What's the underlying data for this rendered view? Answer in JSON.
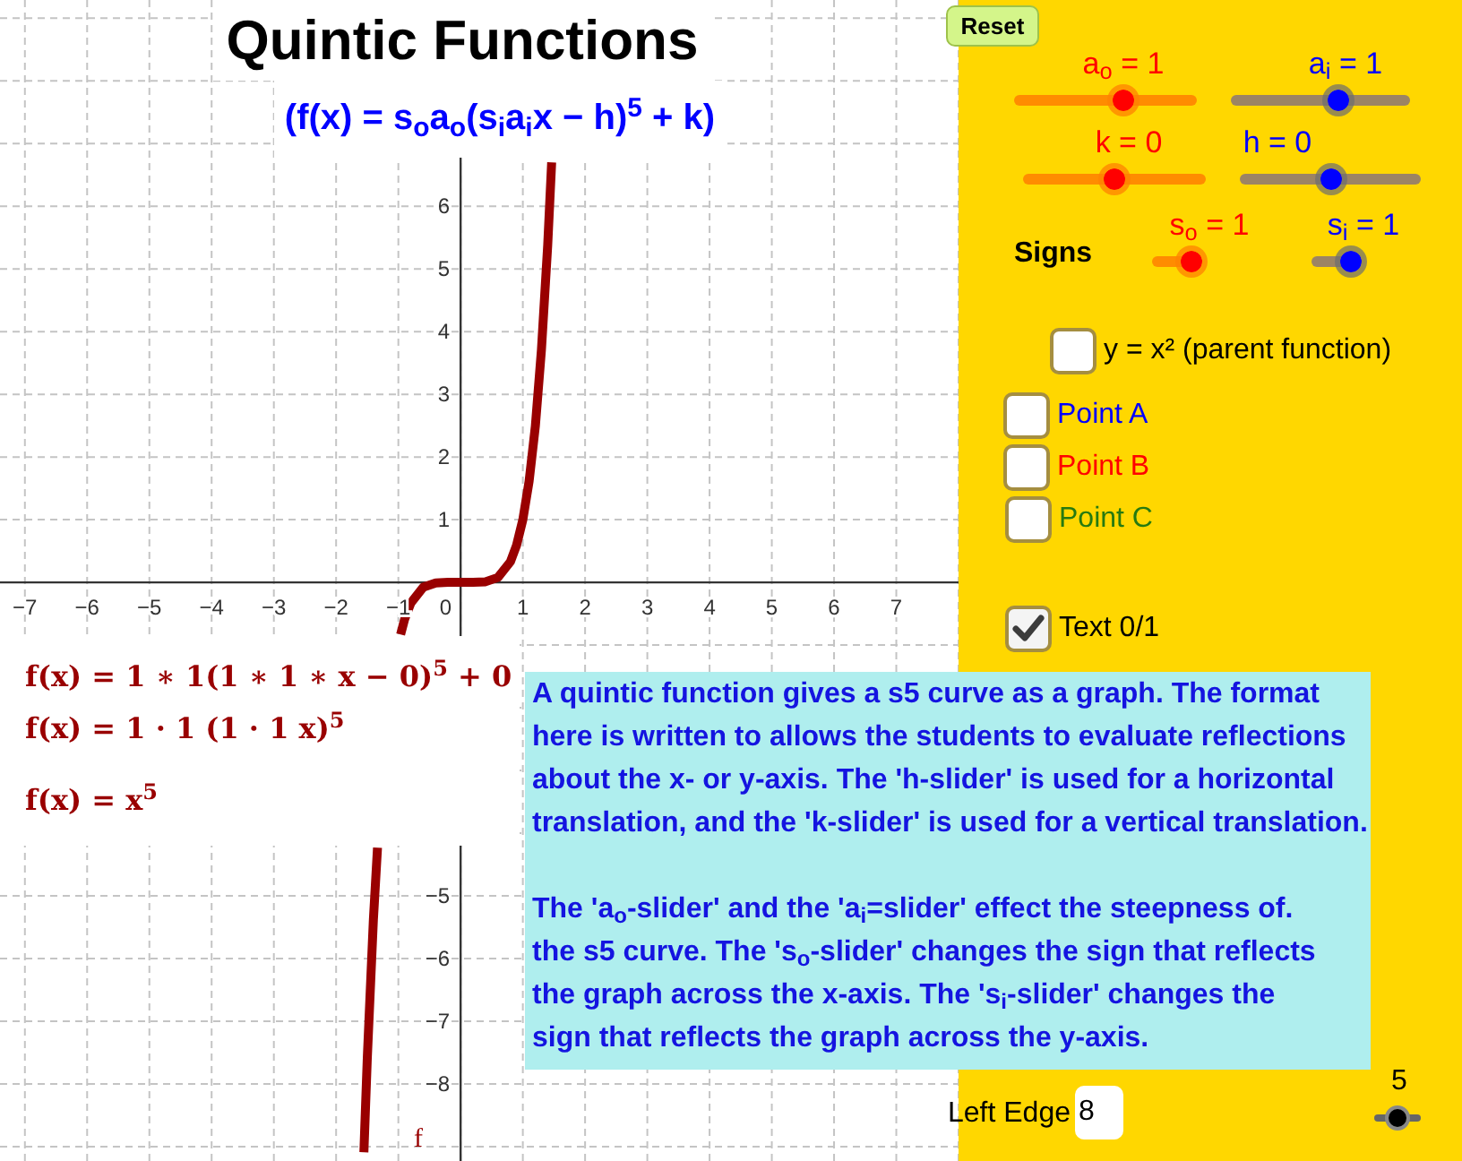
{
  "title": "Quintic Functions",
  "general_form": "(f(x) = s$_{o}$a$_{o}$(s$_{i}$a$_{i}$x − h)$^{5}$ + k)",
  "graph": {
    "origin_label": "0",
    "chart_data": {
      "type": "line",
      "grid": true,
      "x": [
        -1.555,
        -1.5,
        -1.4,
        -1.334,
        -1.1,
        -0.963,
        -0.9,
        -0.8,
        -0.6,
        -0.4,
        -0.2,
        0,
        0.2,
        0.4,
        0.6,
        0.8,
        0.9,
        1,
        1.1,
        1.2,
        1.3,
        1.4,
        1.463
      ],
      "series": [
        {
          "name": "f",
          "color": "#990000",
          "values": [
            -9.09,
            -7.59,
            -5.38,
            -4.23,
            null,
            -0.83,
            -0.59,
            -0.33,
            -0.08,
            -0.01,
            0,
            0,
            0,
            0.01,
            0.08,
            0.33,
            0.59,
            1,
            1.61,
            2.49,
            3.71,
            5.38,
            6.7
          ]
        }
      ],
      "xlim": [
        -7.4,
        8.0
      ],
      "ylim": [
        -9.23,
        9.29
      ],
      "xticks": [
        {
          "value": -7,
          "label": "−7"
        },
        {
          "value": -6,
          "label": "−6"
        },
        {
          "value": -5,
          "label": "−5"
        },
        {
          "value": -4,
          "label": "−4"
        },
        {
          "value": -3,
          "label": "−3"
        },
        {
          "value": -2,
          "label": "−2"
        },
        {
          "value": -1,
          "label": "−1"
        },
        1,
        2,
        3,
        4,
        5,
        6,
        7
      ],
      "yticks": [
        {
          "value": -8,
          "label": "−8"
        },
        {
          "value": -7,
          "label": "−7"
        },
        {
          "value": -6,
          "label": "−6"
        },
        {
          "value": -5,
          "label": "−5"
        },
        1,
        2,
        3,
        4,
        5,
        6
      ]
    }
  },
  "formulas": [
    "f(x) = 1 ∗ 1(1 ∗ 1 ∗ x − 0)$^{5}$ + 0",
    "f(x) = 1 · 1 (1 · 1 x)$^{5}$",
    "f(x) = x$^{5}$"
  ],
  "reset_button": "Reset",
  "sliders": [
    {
      "label": "a$_{o}$ = 1",
      "color": "#ff0000",
      "level": 0.6
    },
    {
      "label": "a$_{i}$ = 1",
      "color": "#0000ff",
      "level": 0.6
    },
    {
      "label": "k = 0",
      "color": "#ff0000",
      "level": 0.5
    },
    {
      "label": "h = 0",
      "color": "#0000ff",
      "level": 0.5
    },
    {
      "label": "s$_{o}$ = 1",
      "color": "#ff0000",
      "level": 1
    },
    {
      "label": "s$_{i}$ = 1",
      "color": "#0000ff",
      "level": 1
    }
  ],
  "signs_label": "Signs",
  "checkboxes": [
    {
      "label": "y = x² (parent function)",
      "color": "#000000",
      "checked": false
    },
    {
      "label": "Point A",
      "color": "#0000ff",
      "checked": false
    },
    {
      "label": "Point B",
      "color": "#ff0000",
      "checked": false
    },
    {
      "label": "Point C",
      "color": "#267a10",
      "checked": false
    },
    {
      "label": "Text 0/1",
      "color": "#000000",
      "checked": true
    }
  ],
  "info_text": [
    "A quintic function gives a s5 curve as a graph. The format\nhere is written to allows the students to evaluate reflections\nabout the x- or y-axis. The 'h-slider' is used for a horizontal\ntranslation, and the 'k-slider' is used for a vertical translation.",
    "The 'a$_{o}$-slider' and the 'a$_{i}$=slider' effect the steepness of.\nthe s5 curve. The 's$_{o}$-slider' changes the sign that reflects\nthe graph across the x-axis. The 's$_{i}$-slider' changes the\nsign that reflects the graph across the y-axis."
  ],
  "left_edge": {
    "label": "Left Edge",
    "value": "8"
  },
  "edge_slider": {
    "label": "5",
    "level": 0.5
  }
}
